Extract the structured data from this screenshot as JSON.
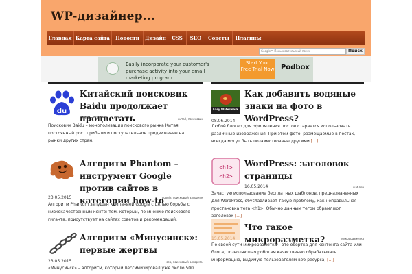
{
  "site": {
    "logo_text": "WP-дизайнер...",
    "nav": [
      "Главная",
      "Карта сайта",
      "Новости",
      "Дизайн",
      "CSS",
      "SEO",
      "Советы",
      "Плагины"
    ],
    "search": {
      "placeholder": "Google™ Пользовательский поиск",
      "button": "Поиск"
    }
  },
  "ad": {
    "text": "Easily incorporate your customer's purchase activity into your email marketing program",
    "cta": "Start Your Free Trial Now",
    "brand": "Podbox"
  },
  "posts_left": [
    {
      "title": "Китайский поисковик Baidu продолжает процветать",
      "date": "23.05.2015",
      "tags": "китай, поисковик",
      "excerpt": "Поисковик Baidu – монополизация поискового рынка Китая, постоянный рост прибыли и поступательное продвижение на рынки других стран."
    },
    {
      "title": "Алгоритм Phantom – инструмент Google против сайтов в категории how-to",
      "date": "23.05.2015",
      "tags": "google, поисковый алгоритм",
      "excerpt": "Алгоритм Phantom запущен компанией Google с целью борьбы с низкокачественным контентом, который, по мнению поискового гиганта, присутствует на сайтах советов и рекомендаций."
    },
    {
      "title": "Алгоритм «Минусинск»: первые жертвы",
      "date": "23.05.2015",
      "tags": "seo, поисковый алгоритм",
      "excerpt": "«Минусинск» – алгоритм, который пессимизировал уже около 500"
    }
  ],
  "posts_right": [
    {
      "title": "Как добавить водяные знаки на фото в WordPress?",
      "thumb_caption": "Easy Watermark",
      "date": "08.06.2014",
      "tags": "",
      "excerpt": "Любой блогер для оформления постов старается использовать различные изображения. При этом фото, размещаемые в постах, всегда могут быть позаимствованы другими",
      "more": "[...]"
    },
    {
      "title": "WordPress: заголовок страницы",
      "date": "16.05.2014",
      "tags": "шаблон",
      "excerpt": "Зачастую использование бесплатных шаблонов, предназначенных для WordPress, обуславливает такую проблему, как неправильная простановка тега <h1>. Обычно данным тегом обрамляют заголовок",
      "more": "[...]"
    },
    {
      "title": "Что такое микроразметка?",
      "date": "15.05.2014",
      "tags": "микроразметка",
      "excerpt": "По своей сути микроразметка – это обертка для контента сайта или блога, позволяющая роботам качественно обрабатывать информацию, видимую пользователям веб-ресурса,",
      "more": "[...]"
    }
  ],
  "colors": {
    "header": "#f9a66c",
    "nav": "#9c3c14",
    "accent": "#b0562a"
  }
}
